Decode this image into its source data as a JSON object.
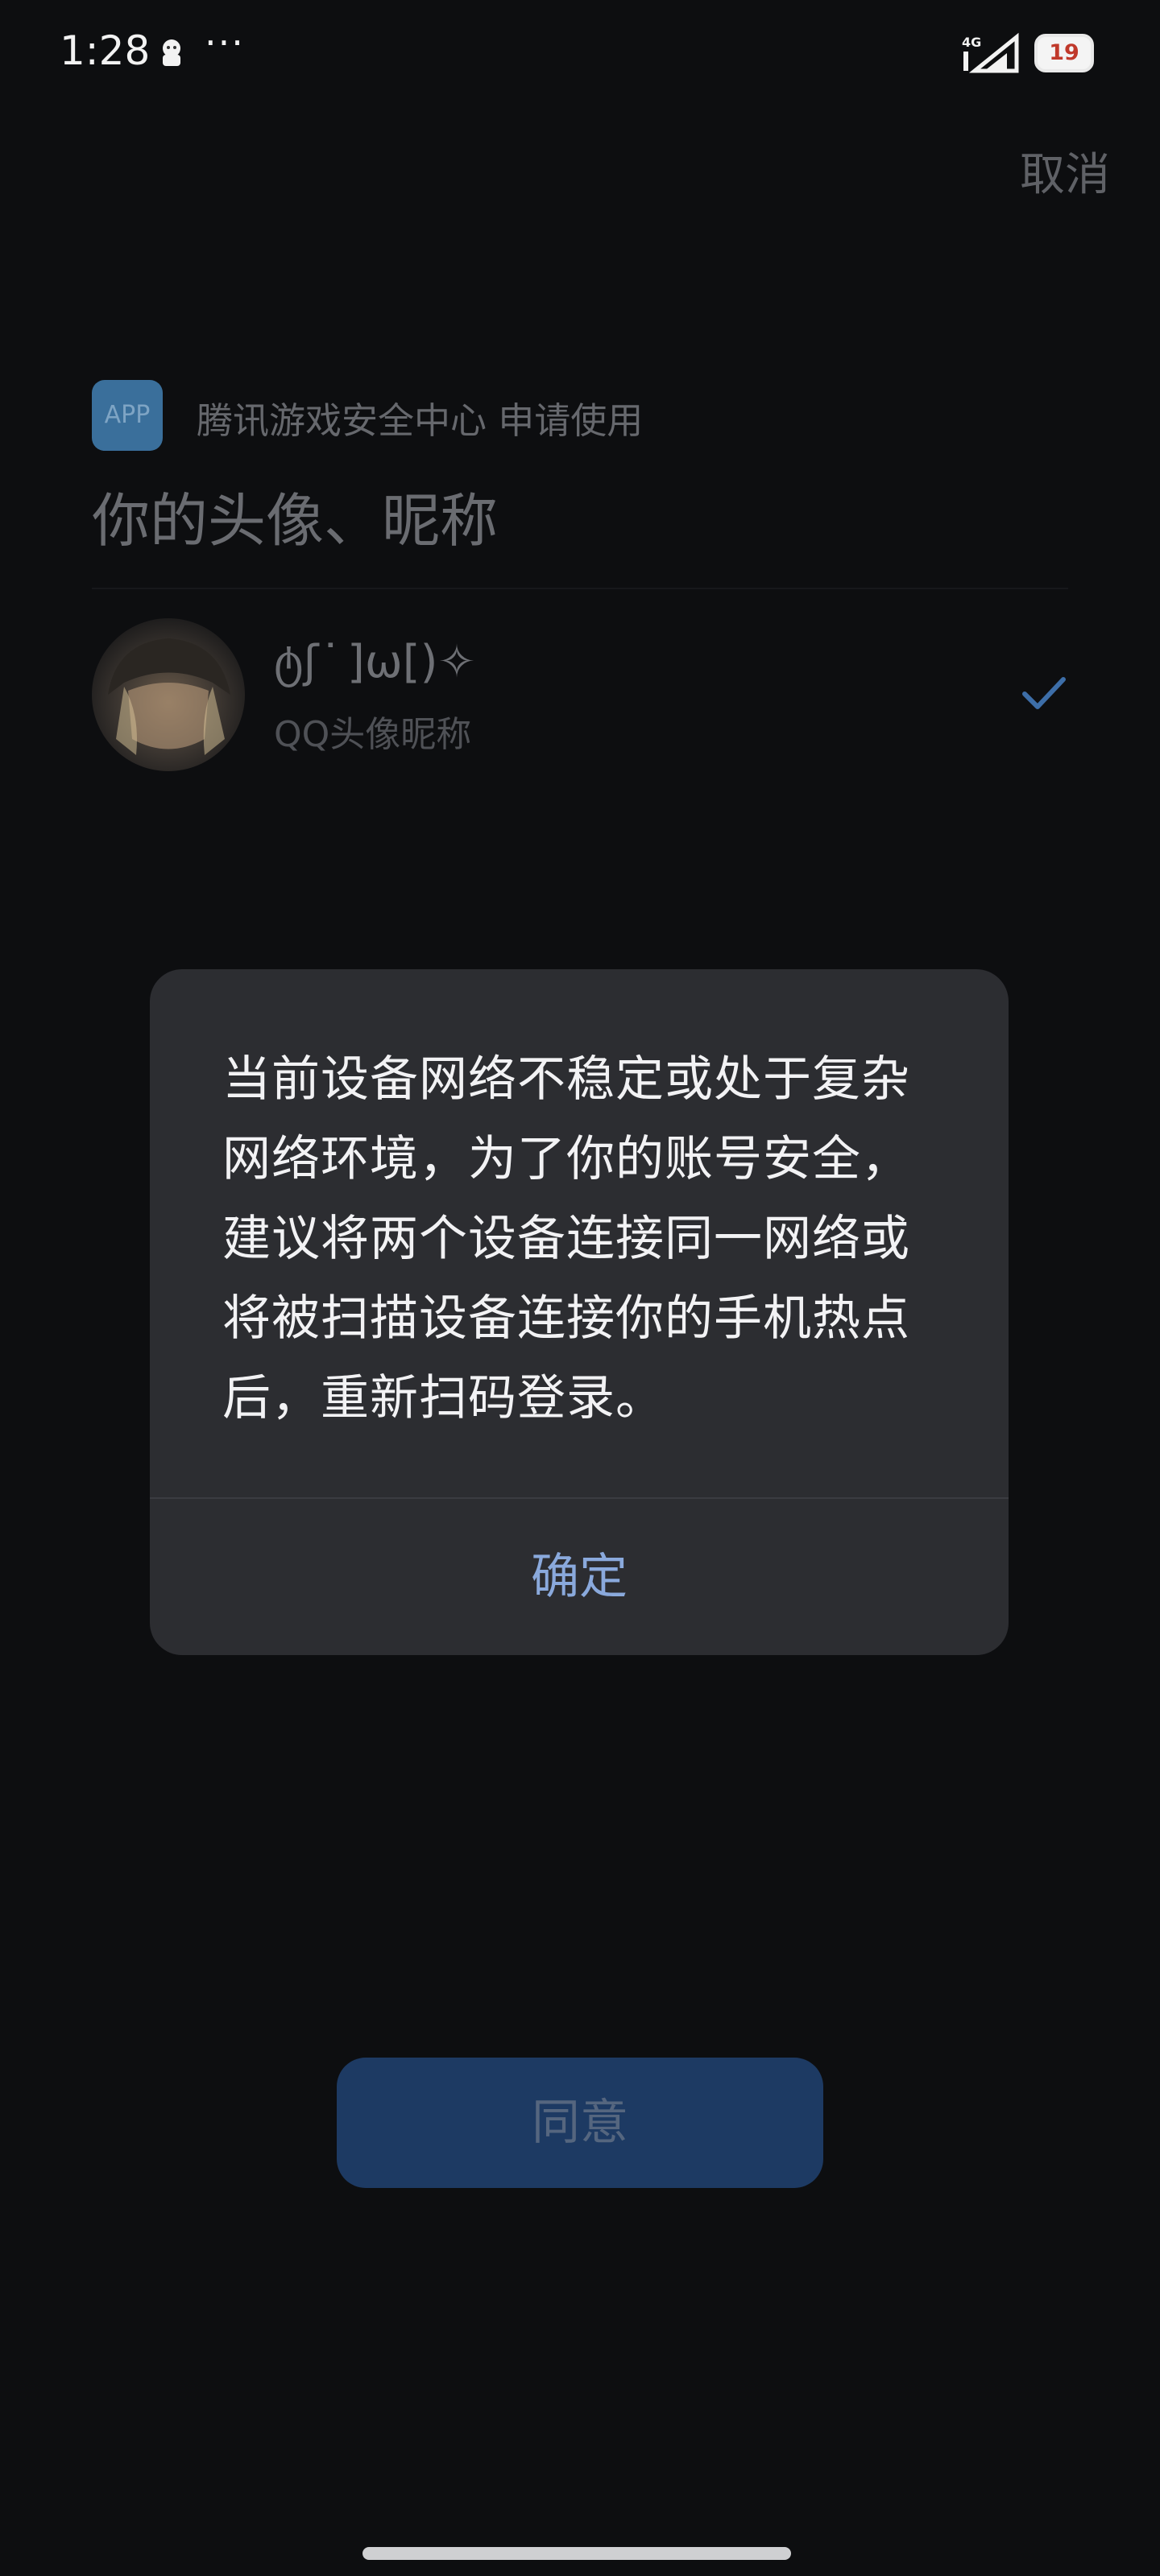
{
  "status_bar": {
    "time": "1:28",
    "more": "···",
    "network": "4G",
    "battery": "19"
  },
  "header": {
    "cancel_label": "取消"
  },
  "auth": {
    "app_icon_label": "APP",
    "request_text": "腾讯游戏安全中心 申请使用",
    "permission_title": "你的头像、昵称",
    "nickname": "ტʃ ͘ ]ω[)✧",
    "nickname_desc": "QQ头像昵称"
  },
  "dialog": {
    "message": "当前设备网络不稳定或处于复杂网络环境，为了你的账号安全，建议将两个设备连接同一网络或将被扫描设备连接你的手机热点后，重新扫码登录。",
    "confirm_label": "确定"
  },
  "footer": {
    "agree_label": "同意"
  },
  "colors": {
    "background": "#0d0e10",
    "dialog_bg": "#2c2d31",
    "accent": "#8aa9dc",
    "check": "#3d6ea8",
    "agree_bg": "#1d3a63"
  }
}
